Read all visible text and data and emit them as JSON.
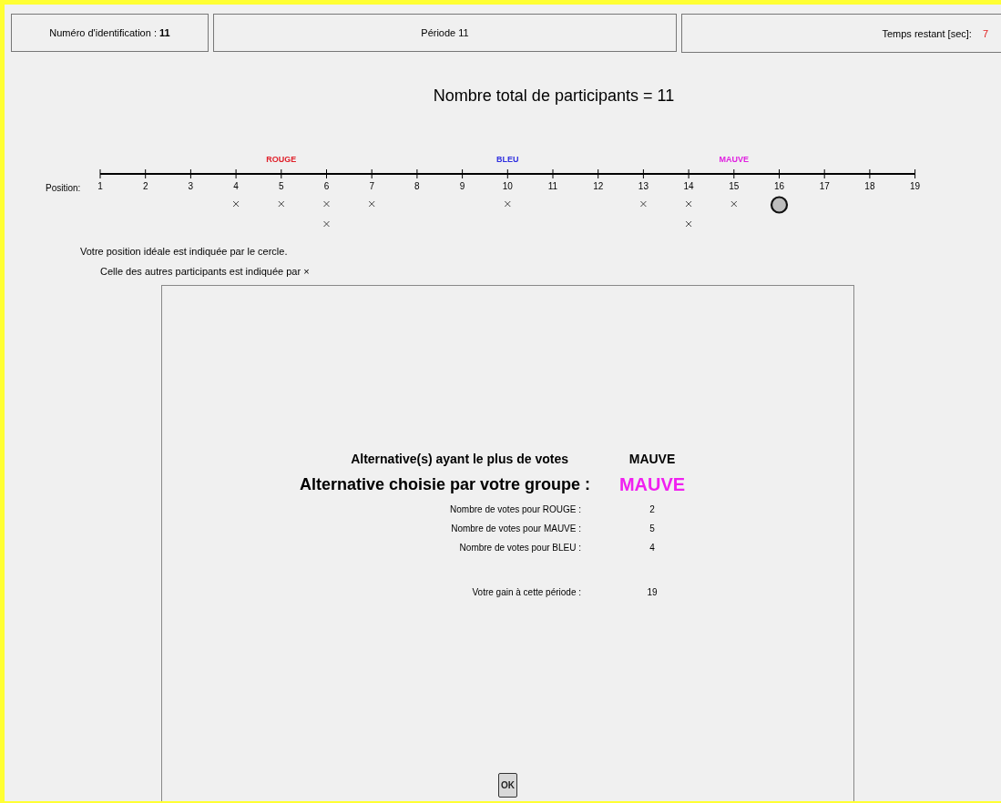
{
  "header": {
    "id_label": "Numéro d'identification :",
    "id_value": "11",
    "period": "Période 11",
    "time_label": "Temps restant [sec]:",
    "time_value": "7"
  },
  "title": "Nombre total de participants = 11",
  "axis": {
    "label": "Position:",
    "ticks": [
      {
        "label": "1"
      },
      {
        "label": "2"
      },
      {
        "label": "3"
      },
      {
        "label": "4",
        "marks": [
          {
            "kind": "other"
          }
        ]
      },
      {
        "label": "5",
        "marks": [
          {
            "kind": "other"
          }
        ],
        "party": {
          "label": "ROUGE",
          "color": "#e0202a"
        }
      },
      {
        "label": "6",
        "marks": [
          {
            "kind": "other"
          },
          {
            "kind": "other"
          }
        ]
      },
      {
        "label": "7",
        "marks": [
          {
            "kind": "other"
          }
        ]
      },
      {
        "label": "8"
      },
      {
        "label": "9"
      },
      {
        "label": "10",
        "marks": [
          {
            "kind": "other"
          }
        ],
        "party": {
          "label": "BLEU",
          "color": "#3030e0"
        }
      },
      {
        "label": "11"
      },
      {
        "label": "12"
      },
      {
        "label": "13",
        "marks": [
          {
            "kind": "other"
          }
        ]
      },
      {
        "label": "14",
        "marks": [
          {
            "kind": "other"
          },
          {
            "kind": "other"
          }
        ]
      },
      {
        "label": "15",
        "marks": [
          {
            "kind": "other"
          }
        ],
        "party": {
          "label": "MAUVE",
          "color": "#e020e0"
        }
      },
      {
        "label": "16",
        "marks": [
          {
            "kind": "self"
          }
        ]
      },
      {
        "label": "17"
      },
      {
        "label": "18"
      },
      {
        "label": "19"
      }
    ]
  },
  "notes": [
    "Votre position idéale est indiquée par le cercle.",
    "Celle des autres participants est indiquée par  ×"
  ],
  "results": [
    {
      "kind": "heading",
      "label": "Alternative(s) ayant le plus de votes",
      "value": "MAUVE"
    },
    {
      "kind": "chosen",
      "label": "Alternative choisie par votre groupe :",
      "value": "MAUVE",
      "color": "#f020f0"
    },
    {
      "kind": "count",
      "label": "Nombre de votes pour ROUGE :",
      "value": "2"
    },
    {
      "kind": "count",
      "label": "Nombre de votes pour MAUVE :",
      "value": "5"
    },
    {
      "kind": "count",
      "label": "Nombre de votes pour BLEU :",
      "value": "4"
    },
    {
      "kind": "gain",
      "label": "Votre gain à cette période :",
      "value": "19"
    }
  ],
  "ok_button": "OK"
}
